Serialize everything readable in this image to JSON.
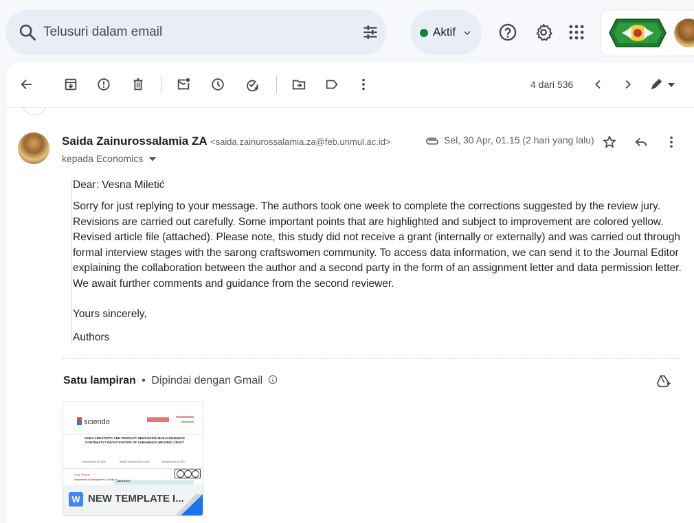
{
  "search": {
    "placeholder": "Telusuri dalam email"
  },
  "status": {
    "label": "Aktif",
    "color": "#188038"
  },
  "toolbar": {
    "pager": "4 dari 536"
  },
  "message": {
    "sender_name": "Saida Zainurossalamia ZA",
    "sender_email": "<saida.zainurossalamia.za@feb.unmul.ac.id>",
    "recipient": "kepada Economics",
    "date": "Sel, 30 Apr, 01.15 (2 hari yang lalu)",
    "greeting": "Dear: Vesna Miletić",
    "paragraph": "Sorry for just replying to your message. The authors took one week to complete the corrections suggested by the review jury. Revisions are carried out carefully. Some important points that are highlighted and subject to improvement are colored yellow. Revised article file (attached). Please note, this study did not receive a grant (internally or externally) and was carried out through formal interview stages with the sarong craftswomen community. To access data information, we can send it to the Journal Editor explaining the collaboration between the author and a second party in the form of an assignment letter and data permission letter. We await further comments and guidance from the second reviewer.",
    "closing": "Yours sincerely,",
    "signature": "Authors"
  },
  "attachments": {
    "title": "Satu lampiran",
    "scanned": "Dipindai dengan Gmail",
    "file_name": "NEW TEMPLATE I...",
    "file_type_badge": "W",
    "preview": {
      "brand": "sciendo",
      "headline": "DOES CREATIVITY AND PRODUCT INNOVATION BUILD BUSINESS CONTINUITY? INVESTIGATION OF SAMARINDA WEAVING CRAFT",
      "received": "Received 00.00.2023",
      "revision": "Submit revision 00.00.2023",
      "accepted": "Accepted 00.00.2023",
      "case_label": "Case Report",
      "dept": "Department of Management, Faculty of",
      "abstract": "ABSTRACT"
    }
  }
}
